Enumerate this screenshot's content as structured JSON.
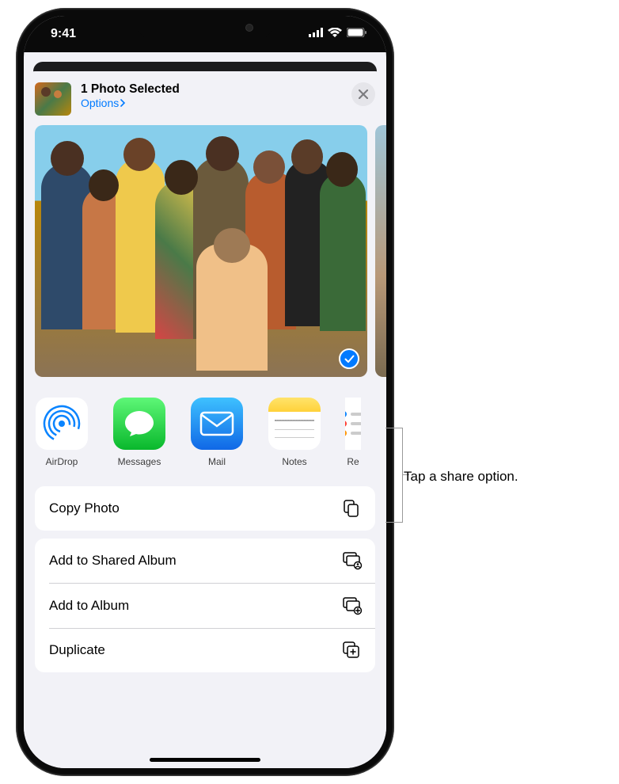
{
  "status": {
    "time": "9:41",
    "signal_icon": "cellular-bars-icon",
    "wifi_icon": "wifi-icon",
    "battery_icon": "battery-icon"
  },
  "header": {
    "title": "1 Photo Selected",
    "options_label": "Options",
    "close_icon": "close-icon"
  },
  "photo": {
    "selected": true,
    "check_icon": "checkmark-icon"
  },
  "apps": [
    {
      "label": "AirDrop",
      "icon": "airdrop-icon",
      "bg": "#ffffff"
    },
    {
      "label": "Messages",
      "icon": "messages-icon",
      "bg": "#33d35e"
    },
    {
      "label": "Mail",
      "icon": "mail-icon",
      "bg": "linear-gradient(180deg,#3ec1ff,#1068e6)"
    },
    {
      "label": "Notes",
      "icon": "notes-icon",
      "bg": "#ffffff"
    },
    {
      "label": "Re",
      "icon": "reminders-icon",
      "bg": "#ffffff"
    }
  ],
  "actions_group1": [
    {
      "label": "Copy Photo",
      "icon": "copy-doc-icon"
    }
  ],
  "actions_group2": [
    {
      "label": "Add to Shared Album",
      "icon": "shared-album-icon"
    },
    {
      "label": "Add to Album",
      "icon": "album-add-icon"
    },
    {
      "label": "Duplicate",
      "icon": "duplicate-icon"
    }
  ],
  "callout": {
    "text": "Tap a share option."
  }
}
